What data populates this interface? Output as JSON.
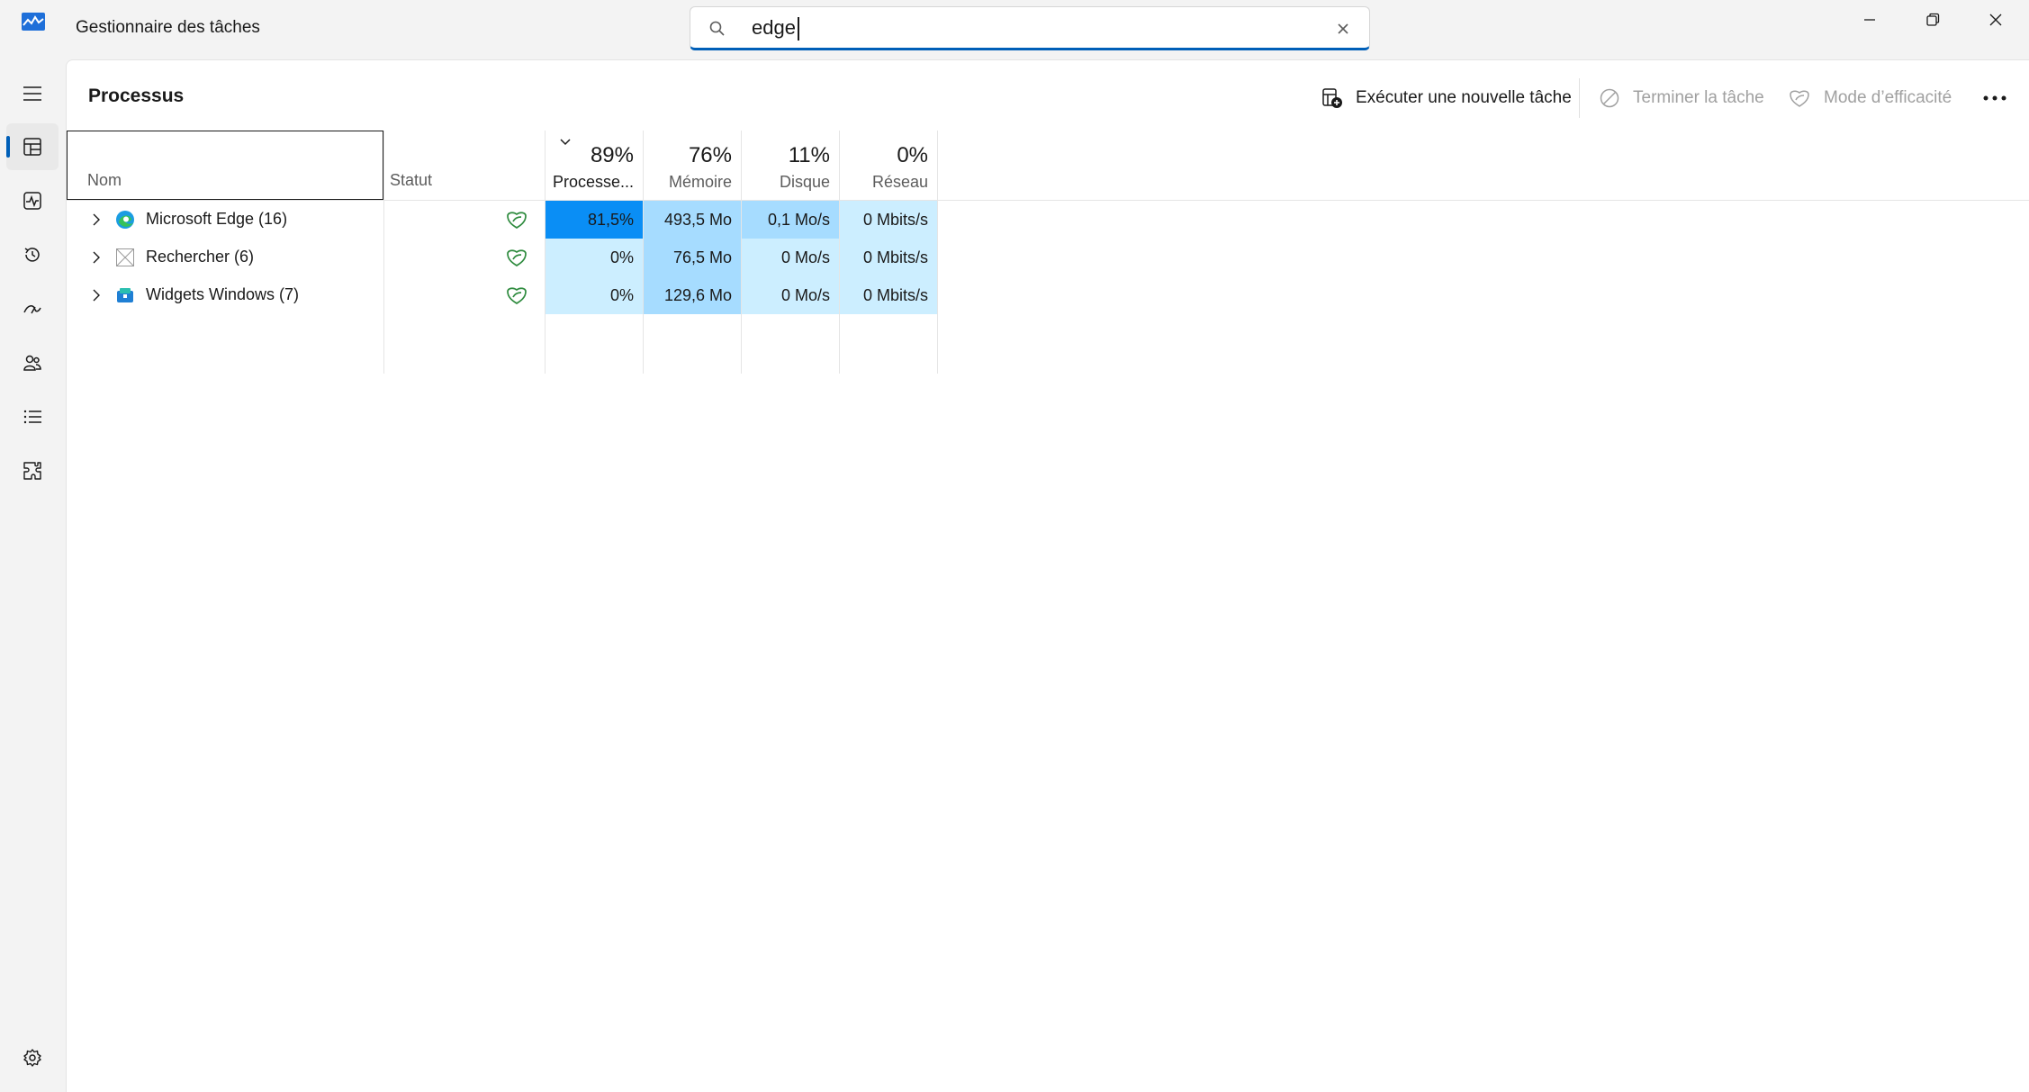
{
  "app": {
    "title": "Gestionnaire des tâches"
  },
  "search": {
    "value": "edge",
    "placeholder": ""
  },
  "window_controls": [
    "minimize-icon",
    "restore-icon",
    "close-icon"
  ],
  "nav": {
    "items": [
      {
        "icon": "hamburger-menu-icon"
      },
      {
        "icon": "processes-icon",
        "active": true
      },
      {
        "icon": "performance-icon"
      },
      {
        "icon": "app-history-icon"
      },
      {
        "icon": "startup-apps-icon"
      },
      {
        "icon": "users-icon"
      },
      {
        "icon": "details-icon"
      },
      {
        "icon": "services-icon"
      }
    ],
    "settings_icon": "settings-icon"
  },
  "page": {
    "title": "Processus",
    "commands": {
      "run_new_task": "Exécuter une nouvelle tâche",
      "end_task": "Terminer la tâche",
      "efficiency_mode": "Mode d’efficacité",
      "more_icon": "more-icon"
    }
  },
  "table": {
    "columns": {
      "name": "Nom",
      "status": "Statut",
      "cpu": {
        "pct": "89%",
        "label": "Processe..."
      },
      "memory": {
        "pct": "76%",
        "label": "Mémoire"
      },
      "disk": {
        "pct": "11%",
        "label": "Disque"
      },
      "network": {
        "pct": "0%",
        "label": "Réseau"
      }
    },
    "rows": [
      {
        "name": "Microsoft Edge (16)",
        "icon": "edge-icon",
        "cpu": "81,5%",
        "memory": "493,5 Mo",
        "disk": "0,1 Mo/s",
        "network": "0 Mbits/s"
      },
      {
        "name": "Rechercher (6)",
        "icon": "search-app-icon",
        "cpu": "0%",
        "memory": "76,5 Mo",
        "disk": "0 Mo/s",
        "network": "0 Mbits/s"
      },
      {
        "name": "Widgets Windows (7)",
        "icon": "widgets-icon",
        "cpu": "0%",
        "memory": "129,6 Mo",
        "disk": "0 Mo/s",
        "network": "0 Mbits/s"
      }
    ]
  },
  "colors": {
    "accent": "#005fb8",
    "heat_high": "#0a8ef5",
    "heat_mid": "#a6dcff",
    "heat_low": "#cceeff",
    "leaf": "#2e8b3e"
  }
}
